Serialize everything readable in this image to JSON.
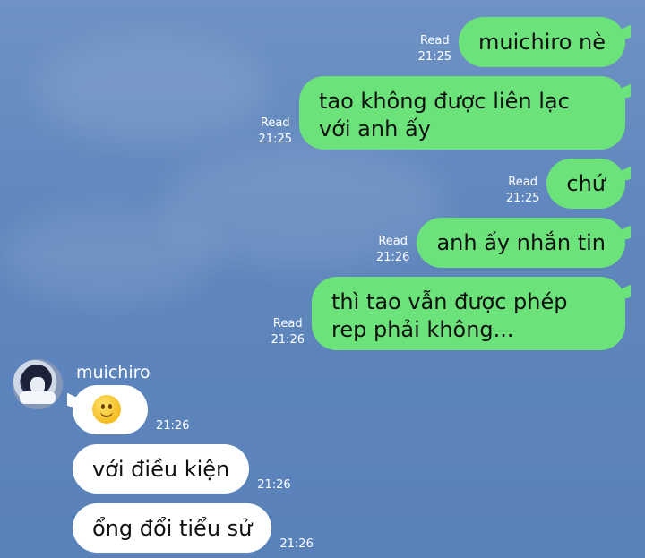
{
  "sent_messages": [
    {
      "text": "muichiro nè",
      "read": "Read",
      "time": "21:25"
    },
    {
      "text": "tao không được liên lạc với anh ấy",
      "read": "Read",
      "time": "21:25"
    },
    {
      "text": "chứ",
      "read": "Read",
      "time": "21:25"
    },
    {
      "text": "anh ấy nhắn tin",
      "read": "Read",
      "time": "21:26"
    },
    {
      "text": "thì tao vẫn được phép rep phải không...",
      "read": "Read",
      "time": "21:26"
    }
  ],
  "contact": {
    "name": "muichiro",
    "avatar_icon": "avatar-icon"
  },
  "received_messages": [
    {
      "emoji": "slightly-smiling-face-emoji",
      "time": "21:26"
    },
    {
      "text": "với điều kiện",
      "time": "21:26"
    },
    {
      "text": "ổng đổi tiểu sử",
      "time": "21:26"
    }
  ],
  "colors": {
    "sent_bubble": "#6ce27a",
    "received_bubble": "#ffffff",
    "background": "#5f86bd"
  }
}
